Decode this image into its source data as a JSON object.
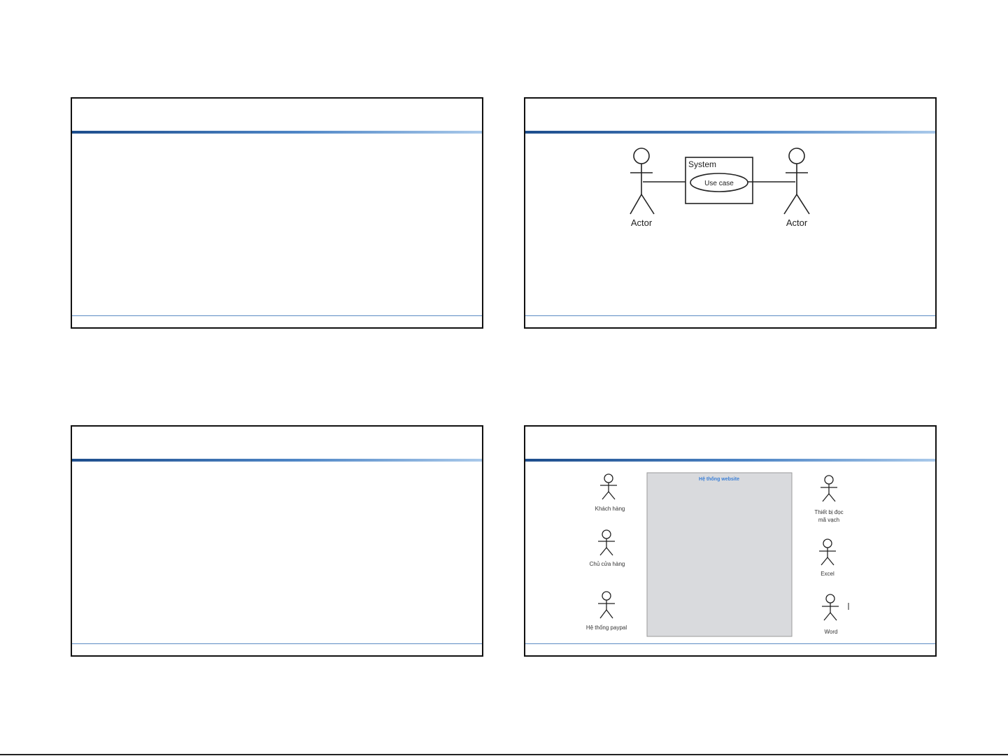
{
  "slide2": {
    "left_actor_label": "Actor",
    "right_actor_label": "Actor",
    "system_label": "System",
    "use_case_label": "Use case"
  },
  "slide4": {
    "system_title": "Hệ thống website",
    "left_actors": [
      "Khách hàng",
      "Chủ cửa hàng",
      "Hệ thống paypal"
    ],
    "right_actors": [
      {
        "line1": "Thiết bị đọc",
        "line2": "mã vạch"
      },
      {
        "line1": "Excel",
        "line2": ""
      },
      {
        "line1": "Word",
        "line2": ""
      }
    ]
  },
  "colors": {
    "title_bar_dark": "#1d4d8c",
    "title_bar_light": "#a9c9ea",
    "footer_line": "#5b8bc4",
    "system_box_fill": "#d9dadd",
    "system_title": "#3b7fd6"
  }
}
